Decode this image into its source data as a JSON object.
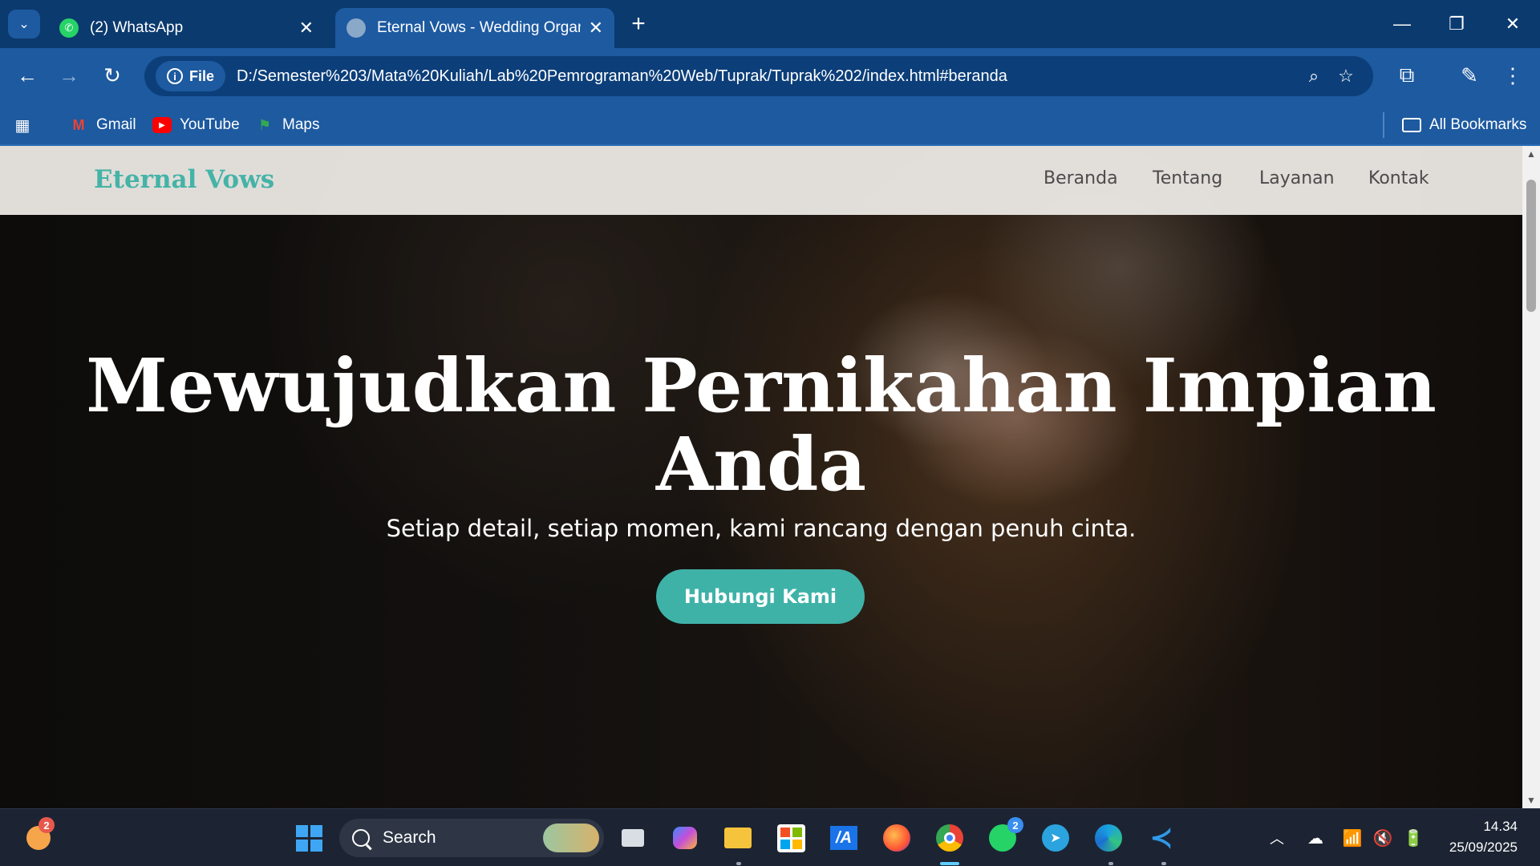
{
  "browser": {
    "tabs": [
      {
        "title": "(2) WhatsApp",
        "active": false
      },
      {
        "title": "Eternal Vows - Wedding Organi",
        "active": true
      }
    ],
    "address": {
      "chip": "File",
      "url": "D:/Semester%203/Mata%20Kuliah/Lab%20Pemrograman%20Web/Tuprak/Tuprak%202/index.html#beranda"
    },
    "bookmarks": [
      "Gmail",
      "YouTube",
      "Maps"
    ],
    "all_bookmarks": "All Bookmarks"
  },
  "site": {
    "brand": "Eternal Vows",
    "nav": [
      "Beranda",
      "Tentang",
      "Layanan",
      "Kontak"
    ],
    "hero": {
      "title_line1": "Mewujudkan Pernikahan Impian",
      "title_line2": "Anda",
      "subtitle": "Setiap detail, setiap momen, kami rancang dengan penuh cinta.",
      "cta": "Hubungi Kami"
    },
    "colors": {
      "accent": "#3fb2a8",
      "brand": "#45b3a7"
    }
  },
  "taskbar": {
    "search_placeholder": "Search",
    "weather_badge": "2",
    "whatsapp_badge": "2",
    "time": "14.34",
    "date": "25/09/2025"
  }
}
